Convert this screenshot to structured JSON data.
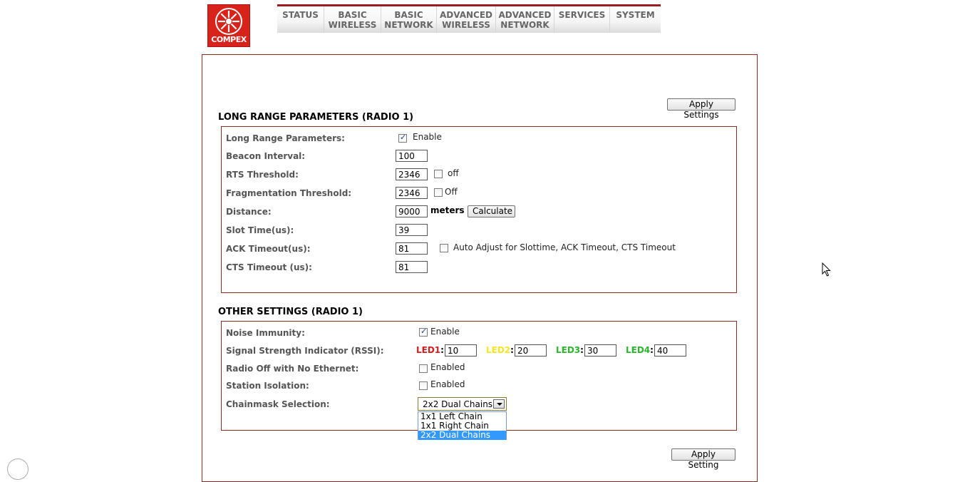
{
  "logo": {
    "text": "COMPEX"
  },
  "nav": {
    "tabs": [
      {
        "line1": "STATUS",
        "line2": ""
      },
      {
        "line1": "BASIC",
        "line2": "WIRELESS"
      },
      {
        "line1": "BASIC",
        "line2": "NETWORK"
      },
      {
        "line1": "ADVANCED",
        "line2": "WIRELESS"
      },
      {
        "line1": "ADVANCED",
        "line2": "NETWORK"
      },
      {
        "line1": "SERVICES",
        "line2": ""
      },
      {
        "line1": "SYSTEM",
        "line2": ""
      }
    ]
  },
  "apply_settings_top": "Apply Settings",
  "apply_setting_bottom": "Apply Setting",
  "long_range": {
    "title": "LONG RANGE PARAMETERS (RADIO 1)",
    "enable_label": "Long Range Parameters:",
    "enable_text": "Enable",
    "enable_checked": true,
    "beacon_label": "Beacon Interval:",
    "beacon_value": "100",
    "rts_label": "RTS Threshold:",
    "rts_value": "2346",
    "rts_off_text": "off",
    "frag_label": "Fragmentation Threshold:",
    "frag_value": "2346",
    "frag_off_text": "Off",
    "distance_label": "Distance:",
    "distance_value": "9000",
    "distance_unit": "meters",
    "calculate_label": "Calculate",
    "slot_label": "Slot Time(us):",
    "slot_value": "39",
    "ack_label": "ACK Timeout(us):",
    "ack_value": "81",
    "auto_adjust_text": "Auto Adjust for Slottime, ACK Timeout, CTS Timeout",
    "cts_label": "CTS Timeout (us):",
    "cts_value": "81"
  },
  "other": {
    "title": "OTHER SETTINGS (RADIO 1)",
    "noise_label": "Noise Immunity:",
    "noise_text": "Enable",
    "noise_checked": true,
    "rssi_label": "Signal Strength Indicator (RSSI):",
    "led1_label": "LED1",
    "led1_value": "10",
    "led2_label": "LED2",
    "led2_value": "20",
    "led3_label": "LED3",
    "led3_value": "30",
    "led4_label": "LED4",
    "led4_value": "40",
    "colon": ":",
    "radio_off_label": "Radio Off with No Ethernet:",
    "radio_off_text": "Enabled",
    "isolation_label": "Station Isolation:",
    "isolation_text": "Enabled",
    "chainmask_label": "Chainmask Selection:",
    "chainmask_value": "2x2 Dual Chains",
    "chainmask_options": [
      "1x1 Left Chain",
      "1x1 Right Chain",
      "2x2 Dual Chains"
    ]
  },
  "colors": {
    "frame_border": "#8b2a1e",
    "nav_top": "#9b1c1c",
    "logo_red": "#d8231b",
    "dropdown_highlight": "#3399ff"
  }
}
